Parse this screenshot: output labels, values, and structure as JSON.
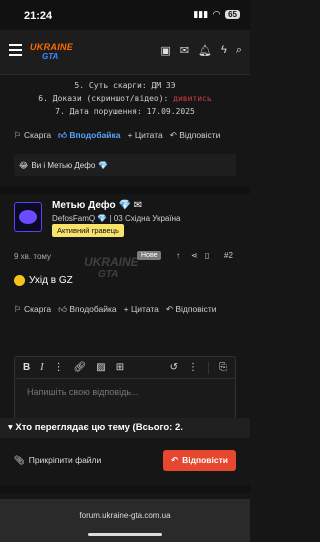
{
  "status_bar": {
    "time": "21:24",
    "battery": "65"
  },
  "nav": {
    "logo_line1": "UKRAINE",
    "logo_line2": "GTA"
  },
  "prev_post": {
    "lines": [
      {
        "text": "5. Суть скарги: ДМ ЗЭ"
      },
      {
        "text": "6. Докази (скриншот/відео): ",
        "link": "дивитись"
      },
      {
        "text": "7. Дата порушення: 17.09.2025"
      }
    ],
    "actions": {
      "complain": "Скарга",
      "like": "Вподобайка",
      "quote": "Цитата",
      "reply": "Відповісти"
    },
    "reactions": "Ви і Метью Дефо"
  },
  "post": {
    "author_name": "Метью Дефо",
    "author_sub": "DefosFamQ 💎 | 03 Східна Україна",
    "badge": "Активний гравець",
    "time_ago": "9 хв. тому",
    "new_label": "Нове",
    "number": "#2",
    "text": "Ухід в GZ",
    "actions": {
      "complain": "Скарга",
      "like": "Вподобайка",
      "quote": "Цитата",
      "reply": "Відповісти"
    }
  },
  "watermark": {
    "line1": "UKRAINE",
    "line2": "GTA"
  },
  "editor": {
    "placeholder": "Напишіть свою відповідь..."
  },
  "attach_label": "Прикріпити файли",
  "reply_button": "Відповісти",
  "viewers_title": "Хто переглядає цю тему (Всього: 2.",
  "url": "forum.ukraine-gta.com.ua"
}
